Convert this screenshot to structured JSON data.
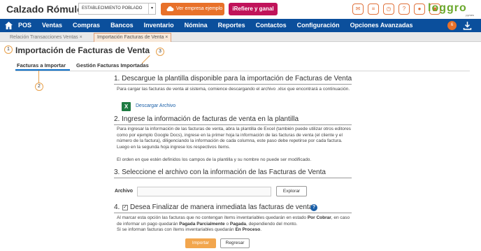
{
  "header": {
    "company_name": "Calzado Rómulo",
    "establishment_select": "ESTABLECIMIENTO POBLADO",
    "sample_company_button": "Ver empresa ejemplo",
    "refer_button": "iRefiere y ganal",
    "logo_main": "loggro",
    "logo_sub": "pymes",
    "icons": [
      "chat-icon",
      "list-icon",
      "clock-icon",
      "help-icon",
      "user-icon",
      "lock-icon"
    ]
  },
  "nav": {
    "items": [
      "POS",
      "Ventas",
      "Compras",
      "Bancos",
      "Inventario",
      "Nómina",
      "Reportes",
      "Contactos",
      "Configuración",
      "Opciones Avanzadas"
    ],
    "badge_count": "6"
  },
  "breadcrumbs": {
    "tab1": "Relación Transacciones Ventas",
    "tab2": "Importación Facturas de Venta"
  },
  "page": {
    "title": "Importación de Facturas de Venta",
    "markers": [
      "1",
      "2",
      "3"
    ],
    "tabs": [
      "Facturas a Importar",
      "Gestión Facturas Importadas"
    ]
  },
  "sections": {
    "s1_title": "1. Descargue la plantilla disponible para la importación de Facturas de Venta",
    "s1_text": "Para cargar las facturas de venta al sistema, comience descargando el archivo .xlsx que encontrará a continuación.",
    "download_label": "Descargar Archivo",
    "s2_title": "2. Ingrese la información de facturas de venta en la plantilla",
    "s2_text": "Para ingresar la información de las facturas de venta, abra la plantilla de Excel (también puede utilizar otros editores como por ejemplo Google Docs), ingrese en la primer hoja la información de las facturas de venta (el cliente y el número de la factura), diligenciando la información de cada columna, este paso debe repetirse por cada factura. Luego en la segunda hoja ingrese los respectivos ítems.",
    "s2_note": "El orden en que estén definidos los campos de la plantilla y su nombre no puede ser modificado.",
    "s3_title": "3. Seleccione el archivo con la información de las Facturas de Venta",
    "file_label": "Archivo",
    "browse_button": "Explorar",
    "s4_title": "4.",
    "s4_check_label": "Desea Finalizar de manera inmediata las facturas de venta",
    "s4_text_1": "Al marcar esta opción las facturas que no contengan ítems inventariables quedarán en estado ",
    "s4_bold_1": "Por Cobrar",
    "s4_text_2": ", en caso de informar un pago quedarán ",
    "s4_bold_2": "Pagada Parcialmente",
    "s4_text_3": " o ",
    "s4_bold_3": "Pagada",
    "s4_text_4": ", dependiendo del monto.",
    "s4_text_5": "Si se informan facturas con ítems inventariables quedarán ",
    "s4_bold_4": "En Proceso",
    "s4_text_6": "."
  },
  "actions": {
    "import_button": "Importar",
    "back_button": "Regresar"
  },
  "colors": {
    "nav_bg": "#0b4f9c",
    "accent_orange": "#e8712a",
    "refer_red": "#c0135a",
    "link_blue": "#1a5fa8"
  }
}
